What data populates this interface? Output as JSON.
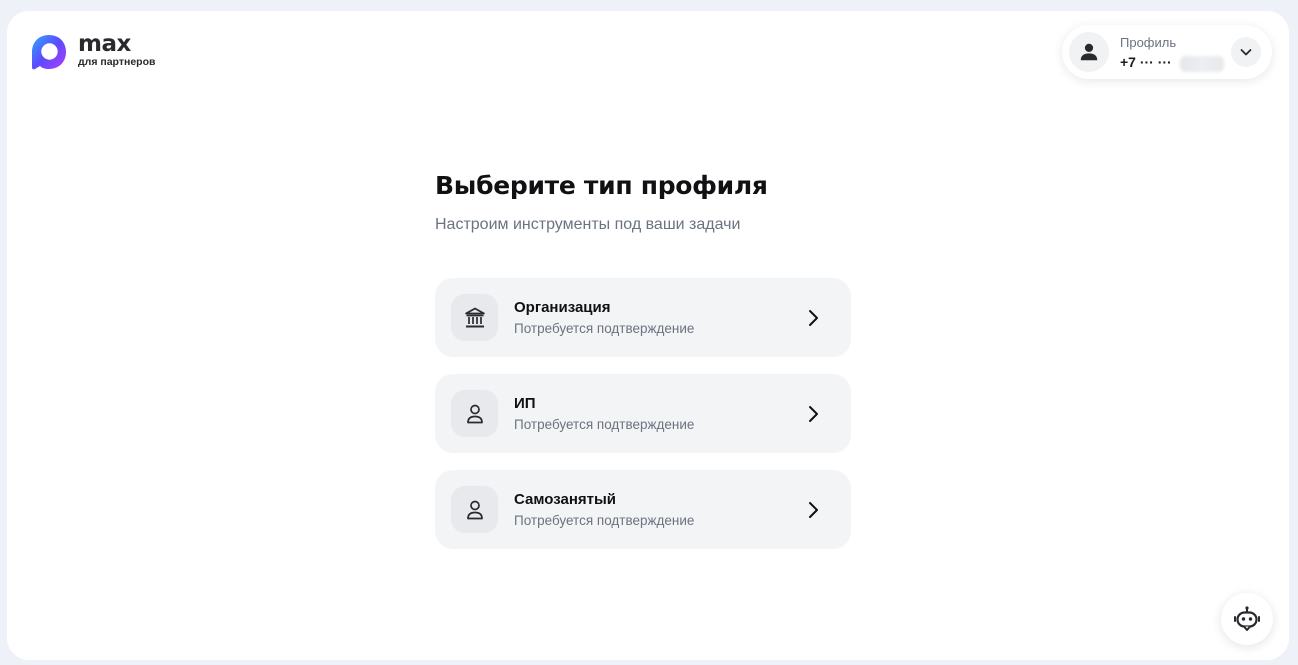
{
  "brand": {
    "name": "max",
    "tagline": "для партнеров",
    "logo_icon": "max-logo-icon",
    "gradient": [
      "#2ea8ff",
      "#5b4bff",
      "#b23cff"
    ]
  },
  "profile": {
    "label": "Профиль",
    "phone": "+7 ··· ···",
    "avatar_icon": "user-icon",
    "menu_icon": "chevron-down-icon"
  },
  "main": {
    "title": "Выберите тип профиля",
    "subtitle": "Настроим инструменты под ваши задачи",
    "options": [
      {
        "title": "Организация",
        "subtitle": "Потребуется подтверждение",
        "icon": "bank-building-icon"
      },
      {
        "title": "ИП",
        "subtitle": "Потребуется подтверждение",
        "icon": "person-icon"
      },
      {
        "title": "Самозанятый",
        "subtitle": "Потребуется подтверждение",
        "icon": "person-icon"
      }
    ]
  },
  "assistant": {
    "icon": "bot-icon"
  },
  "colors": {
    "background": "#eef2f8",
    "card": "#f3f4f6",
    "text_primary": "#111114",
    "text_secondary": "#6b7380"
  }
}
